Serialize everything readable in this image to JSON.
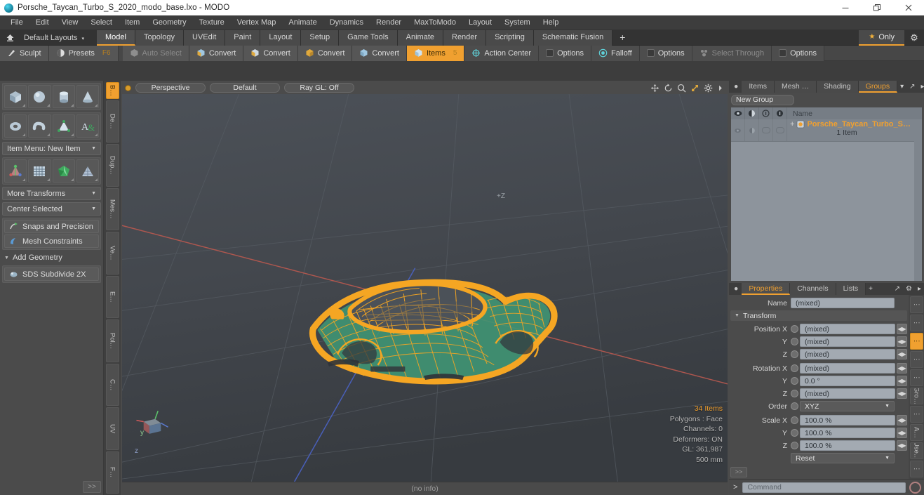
{
  "titlebar": {
    "title": "Porsche_Taycan_Turbo_S_2020_modo_base.lxo - MODO",
    "minimize": "–",
    "maximize": "❐",
    "close": "✕"
  },
  "menubar": {
    "items": [
      "File",
      "Edit",
      "View",
      "Select",
      "Item",
      "Geometry",
      "Texture",
      "Vertex Map",
      "Animate",
      "Dynamics",
      "Render",
      "MaxToModo",
      "Layout",
      "System",
      "Help"
    ]
  },
  "layoutbar": {
    "home_icon": "home-icon",
    "layouts_label": "Default Layouts",
    "caret": "▾",
    "tabs": [
      {
        "label": "Model",
        "active": true
      },
      {
        "label": "Topology",
        "active": false
      },
      {
        "label": "UVEdit",
        "active": false
      },
      {
        "label": "Paint",
        "active": false
      },
      {
        "label": "Layout",
        "active": false
      },
      {
        "label": "Setup",
        "active": false
      },
      {
        "label": "Game Tools",
        "active": false
      },
      {
        "label": "Animate",
        "active": false
      },
      {
        "label": "Render",
        "active": false
      },
      {
        "label": "Scripting",
        "active": false
      },
      {
        "label": "Schematic Fusion",
        "active": false
      }
    ],
    "plus": "+",
    "only_label": "Only",
    "star": "★",
    "gear": "⚙"
  },
  "toolrow": {
    "left": [
      {
        "label": "Sculpt",
        "icon": "brush-icon",
        "state": "normal"
      },
      {
        "label": "Presets",
        "icon": "sphere-icon",
        "state": "normal",
        "badge": "F6"
      }
    ],
    "right": [
      {
        "label": "Auto Select",
        "icon": "cube-gray-icon",
        "state": "dim"
      },
      {
        "label": "Convert",
        "icon": "cube-convert-icon",
        "state": "normal"
      },
      {
        "label": "Convert",
        "icon": "cube-convert-icon",
        "state": "normal"
      },
      {
        "label": "Convert",
        "icon": "cube-convert-icon",
        "state": "normal"
      },
      {
        "label": "Convert",
        "icon": "cube-convert-icon",
        "state": "normal"
      },
      {
        "label": "Items",
        "icon": "cube-items-icon",
        "state": "active",
        "badge": "5"
      },
      {
        "label": "Action Center",
        "icon": "target-icon",
        "state": "normal"
      },
      {
        "label": "Options",
        "icon": "checkbox-icon",
        "state": "normal"
      },
      {
        "label": "Falloff",
        "icon": "falloff-icon",
        "state": "normal"
      },
      {
        "label": "Options",
        "icon": "checkbox-icon",
        "state": "normal"
      },
      {
        "label": "Select Through",
        "icon": "select-through-icon",
        "state": "dim"
      },
      {
        "label": "Options",
        "icon": "checkbox-icon",
        "state": "normal"
      }
    ]
  },
  "leftpanel": {
    "primitives_row1": [
      "cube-primitive",
      "sphere-primitive",
      "cylinder-primitive",
      "cone-primitive"
    ],
    "primitives_row2": [
      "torus-primitive",
      "capsule-primitive",
      "cone-poly-primitive",
      "text-primitive"
    ],
    "item_menu_label": "Item Menu: New Item",
    "tools_row": [
      "transform-tool",
      "grid-tool",
      "gem-tool",
      "plane-tool"
    ],
    "more_transforms_label": "More Transforms",
    "center_selected_label": "Center Selected",
    "snaps_label": "Snaps and Precision",
    "mesh_constraints_label": "Mesh Constraints",
    "add_geometry_label": "Add Geometry",
    "sds_subdivide_label": "SDS Subdivide 2X",
    "more_button": ">>",
    "vtabs": [
      {
        "label": "B…",
        "active": true
      },
      {
        "label": "De…",
        "active": false
      },
      {
        "label": "Dup…",
        "active": false
      },
      {
        "label": "Mes…",
        "active": false
      },
      {
        "label": "Ve…",
        "active": false
      },
      {
        "label": "E…",
        "active": false
      },
      {
        "label": "Pol…",
        "active": false
      },
      {
        "label": "C…",
        "active": false
      },
      {
        "label": "UV",
        "active": false
      },
      {
        "label": "F…",
        "active": false
      }
    ]
  },
  "viewport": {
    "mode_label": "Perspective",
    "shading_label": "Default",
    "raygl_label": "Ray GL: Off",
    "icons": [
      "pan-icon",
      "rotate-icon",
      "zoom-icon",
      "fit-icon",
      "gear-icon",
      "arrow-icon"
    ],
    "axis_plus_z": "+Z",
    "gizmo_labels": {
      "y": "y",
      "z": "z"
    },
    "info": {
      "items": "34 Items",
      "polygons": "Polygons : Face",
      "channels": "Channels: 0",
      "deformers": "Deformers: ON",
      "gl": "GL: 361,987",
      "scale": "500 mm"
    },
    "statusbar": "(no info)"
  },
  "groups_panel": {
    "tabs": [
      {
        "label": "Items",
        "active": false
      },
      {
        "label": "Mesh …",
        "active": false
      },
      {
        "label": "Shading",
        "active": false
      },
      {
        "label": "Groups",
        "active": true
      }
    ],
    "menu_caret": "▾",
    "expand_icon": "expand-icon",
    "arrow_icon": "▸",
    "new_group_label": "New Group",
    "columns": [
      "eye-icon",
      "render-icon",
      "info-icon",
      "lock-icon",
      "Name"
    ],
    "rows": [
      {
        "name": "Porsche_Taycan_Turbo_S…",
        "sub": "1 Item",
        "icon": "group-icon",
        "plus": "+"
      }
    ]
  },
  "properties_panel": {
    "tabs": [
      {
        "label": "Properties",
        "active": true
      },
      {
        "label": "Channels",
        "active": false
      },
      {
        "label": "Lists",
        "active": false
      }
    ],
    "plus": "+",
    "expand_icon": "expand-icon",
    "gear_icon": "⚙",
    "arrow_icon": "▸",
    "name_label": "Name",
    "name_value": "(mixed)",
    "transform_label": "Transform",
    "rows": [
      {
        "label": "Position X",
        "value": "(mixed)"
      },
      {
        "label": "Y",
        "value": "(mixed)"
      },
      {
        "label": "Z",
        "value": "(mixed)"
      },
      {
        "label": "Rotation X",
        "value": "(mixed)"
      },
      {
        "label": "Y",
        "value": "0.0 °"
      },
      {
        "label": "Z",
        "value": "(mixed)"
      }
    ],
    "order_label": "Order",
    "order_value": "XYZ",
    "scale_rows": [
      {
        "label": "Scale X",
        "value": "100.0 %"
      },
      {
        "label": "Y",
        "value": "100.0 %"
      },
      {
        "label": "Z",
        "value": "100.0 %"
      }
    ],
    "reset_label": "Reset",
    "more_button": ">>",
    "vtabs": [
      {
        "label": "⋮",
        "active": false
      },
      {
        "label": "⋮",
        "active": false
      },
      {
        "label": "⋮",
        "active": true
      },
      {
        "label": "⋮",
        "active": false
      },
      {
        "label": "⋮",
        "active": false
      },
      {
        "label": "Gro…",
        "active": false
      },
      {
        "label": "⋮",
        "active": false
      },
      {
        "label": "A…",
        "active": false
      },
      {
        "label": "Use…",
        "active": false
      },
      {
        "label": "⋮",
        "active": false
      }
    ]
  },
  "commandbar": {
    "prompt": "&gt;",
    "placeholder": "Command",
    "record_icon": "record-icon"
  },
  "colors": {
    "accent": "#f0a030",
    "panel": "#4b4b4b",
    "field": "#a3aab2",
    "mesh_orange": "#f5a623",
    "mesh_green": "#46a07a"
  }
}
